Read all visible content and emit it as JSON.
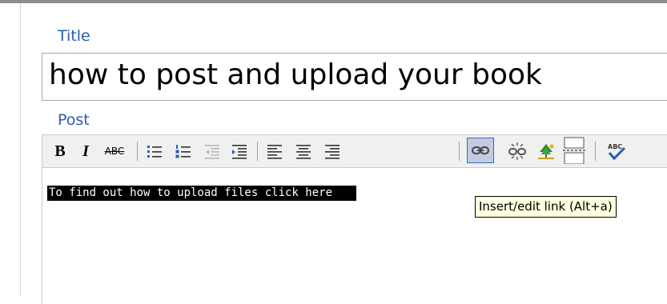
{
  "form": {
    "title_label": "Title",
    "title_value": "how to post and upload your book",
    "post_label": "Post"
  },
  "toolbar": {
    "bold_label": "B",
    "italic_label": "I",
    "strike_label": "ABC",
    "icons": [
      "bold-icon",
      "italic-icon",
      "strikethrough-icon",
      "bullet-list-icon",
      "numbered-list-icon",
      "outdent-icon",
      "indent-icon",
      "align-left-icon",
      "align-center-icon",
      "align-right-icon",
      "link-icon",
      "unlink-icon",
      "image-icon",
      "page-break-icon",
      "spellcheck-icon"
    ],
    "active_button": "link-icon"
  },
  "editor": {
    "selected_text": "To find out how to upload files click here"
  },
  "tooltip": {
    "text": "Insert/edit link (Alt+a)"
  },
  "colors": {
    "label": "#2a5db0",
    "toolbar_bg": "#f0f0ee",
    "active_button_bg": "#c2cbe0",
    "active_button_border": "#316ac5",
    "selection_bg": "#000000",
    "tooltip_bg": "#ffffe1"
  }
}
